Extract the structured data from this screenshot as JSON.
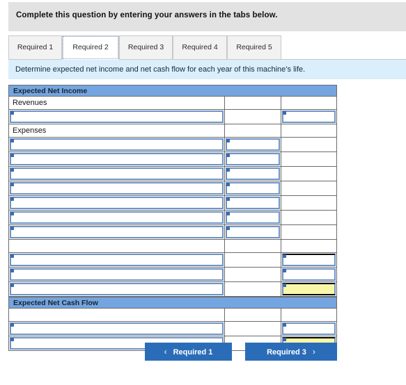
{
  "banner": {
    "instruction": "Complete this question by entering your answers in the tabs below."
  },
  "tabs": {
    "items": [
      {
        "label": "Required 1",
        "active": false
      },
      {
        "label": "Required 2",
        "active": true
      },
      {
        "label": "Required 3",
        "active": false
      },
      {
        "label": "Required 4",
        "active": false
      },
      {
        "label": "Required 5",
        "active": false
      }
    ]
  },
  "requirement": {
    "text": "Determine expected net income and net cash flow for each year of this machine’s life."
  },
  "worksheet": {
    "section_net_income": "Expected Net Income",
    "section_net_cash_flow": "Expected Net Cash Flow",
    "label_revenues": "Revenues",
    "label_expenses": "Expenses",
    "input_value": "",
    "input_placeholder": ""
  },
  "nav": {
    "prev_label": "Required 1",
    "next_label": "Required 3",
    "prev_chevron": "‹",
    "next_chevron": "›"
  },
  "colors": {
    "section_header": "#74a5e0",
    "requirement_bar": "#dbeefb",
    "banner_bg": "#e2e2e2",
    "button": "#2b6cb8",
    "total_highlight": "#f8f7a8",
    "input_border": "#6e93c4",
    "grid_line": "#6b6b6b"
  }
}
